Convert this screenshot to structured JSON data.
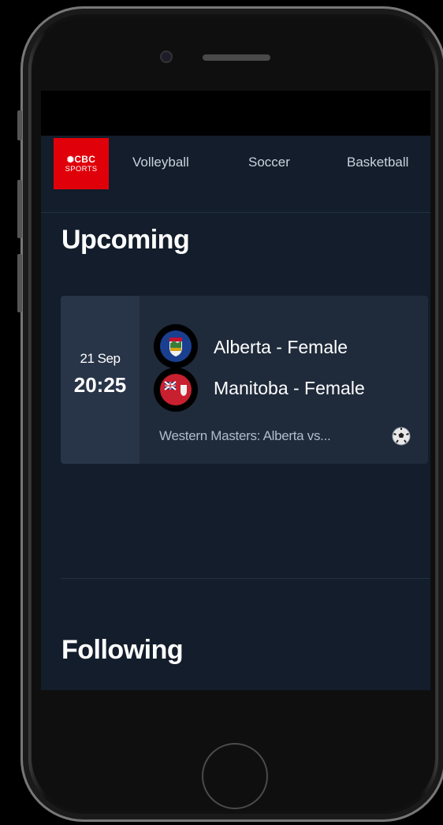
{
  "nav": {
    "logo_top": "CBC",
    "logo_bottom": "SPORTS",
    "items": [
      {
        "label": "Volleyball"
      },
      {
        "label": "Soccer"
      },
      {
        "label": "Basketball"
      }
    ]
  },
  "upcoming": {
    "title": "Upcoming",
    "events": [
      {
        "date": "21 Sep",
        "time": "20:25",
        "teams": [
          {
            "name": "Alberta - Female",
            "flag_icon": "alberta-flag-icon"
          },
          {
            "name": "Manitoba - Female",
            "flag_icon": "manitoba-flag-icon"
          }
        ],
        "subtitle": "Western Masters: Alberta vs...",
        "sport_icon": "soccer-ball-icon"
      }
    ]
  },
  "following": {
    "title": "Following"
  },
  "colors": {
    "brand": "#e0000a",
    "app_background": "#131d2b",
    "card": "#1f2a3a",
    "card_date": "#283448"
  }
}
